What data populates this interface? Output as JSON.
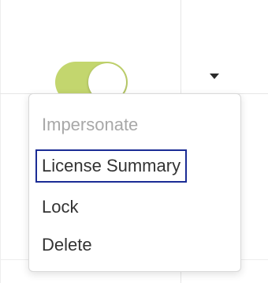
{
  "toggle": {
    "state": "on",
    "track_color": "#c3d66e"
  },
  "dropdown_button": {
    "icon": "caret-down-icon"
  },
  "menu": {
    "items": [
      {
        "label": "Impersonate",
        "disabled": true
      },
      {
        "label": "License Summary",
        "focused": true
      },
      {
        "label": "Lock"
      },
      {
        "label": "Delete"
      }
    ],
    "focus_color": "#1b2c95"
  }
}
